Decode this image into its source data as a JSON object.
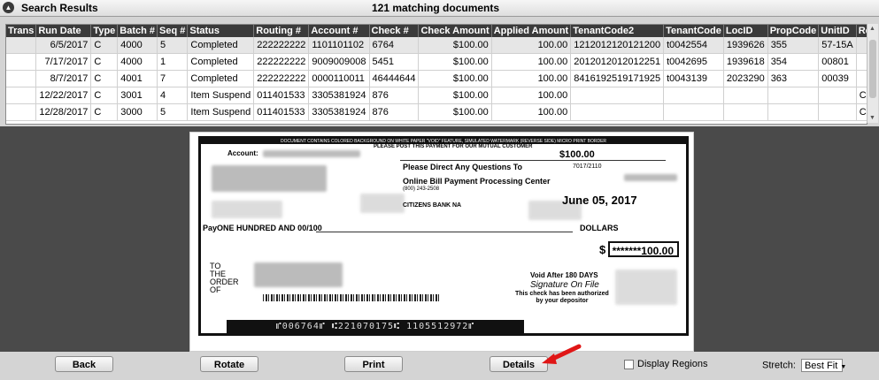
{
  "header": {
    "title": "Search Results",
    "match_count": "121 matching documents"
  },
  "grid": {
    "columns": [
      "Trans",
      "Run Date",
      "Type",
      "Batch #",
      "Seq #",
      "Status",
      "Routing #",
      "Account #",
      "Check #",
      "Check Amount",
      "Applied Amount",
      "TenantCode2",
      "TenantCode",
      "LocID",
      "PropCode",
      "UnitID",
      "Reason"
    ],
    "rows": [
      [
        "",
        "6/5/2017",
        "C",
        "4000",
        "5",
        "Completed",
        "222222222",
        "1101101102",
        "6764",
        "$100.00",
        "100.00",
        "1212012120121200",
        "t0042554",
        "1939626",
        "355",
        "57-15A",
        ""
      ],
      [
        "",
        "7/17/2017",
        "C",
        "4000",
        "1",
        "Completed",
        "222222222",
        "9009009008",
        "5451",
        "$100.00",
        "100.00",
        "2012012012012251",
        "t0042695",
        "1939618",
        "354",
        "00801",
        ""
      ],
      [
        "",
        "8/7/2017",
        "C",
        "4001",
        "7",
        "Completed",
        "222222222",
        "0000110011",
        "46444644",
        "$100.00",
        "100.00",
        "8416192519171925",
        "t0043139",
        "2023290",
        "363",
        "00039",
        ""
      ],
      [
        "",
        "12/22/2017",
        "C",
        "3001",
        "4",
        "Item Suspend",
        "011401533",
        "3305381924",
        "876",
        "$100.00",
        "100.00",
        "",
        "",
        "",
        "",
        "",
        "Can Not ID"
      ],
      [
        "",
        "12/28/2017",
        "C",
        "3000",
        "5",
        "Item Suspend",
        "011401533",
        "3305381924",
        "876",
        "$100.00",
        "100.00",
        "",
        "",
        "",
        "",
        "",
        "Can Not ID"
      ]
    ]
  },
  "check": {
    "banner": "DOCUMENT CONTAINS COLORED BACKGROUND ON WHITE PAPER \"VOID\" FEATURE, SIMULATED WATERMARK (REVERSE SIDE) MICRO PRINT BORDER",
    "please_post": "PLEASE POST THIS PAYMENT FOR OUR MUTUAL CUSTOMER",
    "account_label": "Account:",
    "amount_top": "$100.00",
    "direct_questions": "Please Direct Any Questions To",
    "routing_fraction": "7017/2110",
    "processor": "Online Bill Payment Processing Center",
    "phone": "(800) 243-2508",
    "date": "June 05, 2017",
    "bank": "CITIZENS BANK NA",
    "pay_text": "PayONE HUNDRED AND 00/100",
    "dollars": "DOLLARS",
    "dollar_sign": "$",
    "amount_box": "*******100.00",
    "to_the_order_of": [
      "TO",
      "THE",
      "ORDER",
      "OF"
    ],
    "void_after": "Void After  180 DAYS",
    "signature": "Signature On File",
    "authorized": [
      "This check has been authorized",
      "by your depositor"
    ],
    "micr": "⑈006764⑈   ⑆221070175⑆  1105512972⑈"
  },
  "buttons": {
    "back": "Back",
    "rotate": "Rotate",
    "print": "Print",
    "details": "Details"
  },
  "display_regions": "Display Regions",
  "stretch": {
    "label": "Stretch:",
    "value": "Best Fit"
  }
}
